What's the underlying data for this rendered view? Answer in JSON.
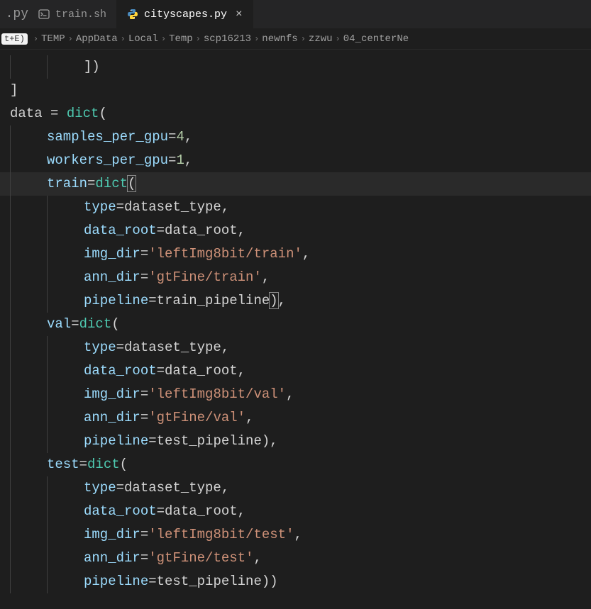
{
  "tabs": {
    "partial_left": ".py",
    "items": [
      {
        "icon": "shell",
        "label": "train.sh",
        "active": false
      },
      {
        "icon": "python",
        "label": "cityscapes.py",
        "active": true
      }
    ],
    "close_glyph": "×"
  },
  "breadcrumbs": {
    "hint": "t+E)",
    "items": [
      "TEMP",
      "AppData",
      "Local",
      "Temp",
      "scp16213",
      "newnfs",
      "zzwu",
      "04_centerNe"
    ]
  },
  "code": {
    "lines": [
      {
        "indent": 2,
        "tokens": [
          {
            "t": "])",
            "c": "punc"
          }
        ]
      },
      {
        "indent": 0,
        "tokens": [
          {
            "t": "]",
            "c": "punc"
          }
        ]
      },
      {
        "indent": 0,
        "tokens": [
          {
            "t": "data",
            "c": "plain"
          },
          {
            "t": " = ",
            "c": "op"
          },
          {
            "t": "dict",
            "c": "func"
          },
          {
            "t": "(",
            "c": "punc"
          }
        ]
      },
      {
        "indent": 1,
        "tokens": [
          {
            "t": "samples_per_gpu",
            "c": "param"
          },
          {
            "t": "=",
            "c": "op"
          },
          {
            "t": "4",
            "c": "num"
          },
          {
            "t": ",",
            "c": "punc"
          }
        ]
      },
      {
        "indent": 1,
        "tokens": [
          {
            "t": "workers_per_gpu",
            "c": "param"
          },
          {
            "t": "=",
            "c": "op"
          },
          {
            "t": "1",
            "c": "num"
          },
          {
            "t": ",",
            "c": "punc"
          }
        ]
      },
      {
        "indent": 1,
        "hl": true,
        "tokens": [
          {
            "t": "train",
            "c": "param"
          },
          {
            "t": "=",
            "c": "op"
          },
          {
            "t": "dict",
            "c": "func"
          },
          {
            "t": "(",
            "c": "punc",
            "bm": true
          }
        ]
      },
      {
        "indent": 2,
        "tokens": [
          {
            "t": "type",
            "c": "param"
          },
          {
            "t": "=",
            "c": "op"
          },
          {
            "t": "dataset_type",
            "c": "plain"
          },
          {
            "t": ",",
            "c": "punc"
          }
        ]
      },
      {
        "indent": 2,
        "tokens": [
          {
            "t": "data_root",
            "c": "param"
          },
          {
            "t": "=",
            "c": "op"
          },
          {
            "t": "data_root",
            "c": "plain"
          },
          {
            "t": ",",
            "c": "punc"
          }
        ]
      },
      {
        "indent": 2,
        "tokens": [
          {
            "t": "img_dir",
            "c": "param"
          },
          {
            "t": "=",
            "c": "op"
          },
          {
            "t": "'leftImg8bit/train'",
            "c": "str"
          },
          {
            "t": ",",
            "c": "punc"
          }
        ]
      },
      {
        "indent": 2,
        "tokens": [
          {
            "t": "ann_dir",
            "c": "param"
          },
          {
            "t": "=",
            "c": "op"
          },
          {
            "t": "'gtFine/train'",
            "c": "str"
          },
          {
            "t": ",",
            "c": "punc"
          }
        ]
      },
      {
        "indent": 2,
        "tokens": [
          {
            "t": "pipeline",
            "c": "param"
          },
          {
            "t": "=",
            "c": "op"
          },
          {
            "t": "train_pipeline",
            "c": "plain"
          },
          {
            "t": ")",
            "c": "punc",
            "bm": true
          },
          {
            "t": ",",
            "c": "punc"
          }
        ]
      },
      {
        "indent": 1,
        "tokens": [
          {
            "t": "val",
            "c": "param"
          },
          {
            "t": "=",
            "c": "op"
          },
          {
            "t": "dict",
            "c": "func"
          },
          {
            "t": "(",
            "c": "punc"
          }
        ]
      },
      {
        "indent": 2,
        "tokens": [
          {
            "t": "type",
            "c": "param"
          },
          {
            "t": "=",
            "c": "op"
          },
          {
            "t": "dataset_type",
            "c": "plain"
          },
          {
            "t": ",",
            "c": "punc"
          }
        ]
      },
      {
        "indent": 2,
        "tokens": [
          {
            "t": "data_root",
            "c": "param"
          },
          {
            "t": "=",
            "c": "op"
          },
          {
            "t": "data_root",
            "c": "plain"
          },
          {
            "t": ",",
            "c": "punc"
          }
        ]
      },
      {
        "indent": 2,
        "tokens": [
          {
            "t": "img_dir",
            "c": "param"
          },
          {
            "t": "=",
            "c": "op"
          },
          {
            "t": "'leftImg8bit/val'",
            "c": "str"
          },
          {
            "t": ",",
            "c": "punc"
          }
        ]
      },
      {
        "indent": 2,
        "tokens": [
          {
            "t": "ann_dir",
            "c": "param"
          },
          {
            "t": "=",
            "c": "op"
          },
          {
            "t": "'gtFine/val'",
            "c": "str"
          },
          {
            "t": ",",
            "c": "punc"
          }
        ]
      },
      {
        "indent": 2,
        "tokens": [
          {
            "t": "pipeline",
            "c": "param"
          },
          {
            "t": "=",
            "c": "op"
          },
          {
            "t": "test_pipeline",
            "c": "plain"
          },
          {
            "t": "),",
            "c": "punc"
          }
        ]
      },
      {
        "indent": 1,
        "tokens": [
          {
            "t": "test",
            "c": "param"
          },
          {
            "t": "=",
            "c": "op"
          },
          {
            "t": "dict",
            "c": "func"
          },
          {
            "t": "(",
            "c": "punc"
          }
        ]
      },
      {
        "indent": 2,
        "tokens": [
          {
            "t": "type",
            "c": "param"
          },
          {
            "t": "=",
            "c": "op"
          },
          {
            "t": "dataset_type",
            "c": "plain"
          },
          {
            "t": ",",
            "c": "punc"
          }
        ]
      },
      {
        "indent": 2,
        "tokens": [
          {
            "t": "data_root",
            "c": "param"
          },
          {
            "t": "=",
            "c": "op"
          },
          {
            "t": "data_root",
            "c": "plain"
          },
          {
            "t": ",",
            "c": "punc"
          }
        ]
      },
      {
        "indent": 2,
        "tokens": [
          {
            "t": "img_dir",
            "c": "param"
          },
          {
            "t": "=",
            "c": "op"
          },
          {
            "t": "'leftImg8bit/test'",
            "c": "str"
          },
          {
            "t": ",",
            "c": "punc"
          }
        ]
      },
      {
        "indent": 2,
        "tokens": [
          {
            "t": "ann_dir",
            "c": "param"
          },
          {
            "t": "=",
            "c": "op"
          },
          {
            "t": "'gtFine/test'",
            "c": "str"
          },
          {
            "t": ",",
            "c": "punc"
          }
        ]
      },
      {
        "indent": 2,
        "tokens": [
          {
            "t": "pipeline",
            "c": "param"
          },
          {
            "t": "=",
            "c": "op"
          },
          {
            "t": "test_pipeline",
            "c": "plain"
          },
          {
            "t": "))",
            "c": "punc"
          }
        ]
      }
    ]
  },
  "icons": {
    "shell_color": "#a0a0a0",
    "python_color_a": "#4B8BBE",
    "python_color_b": "#FFD43B"
  }
}
